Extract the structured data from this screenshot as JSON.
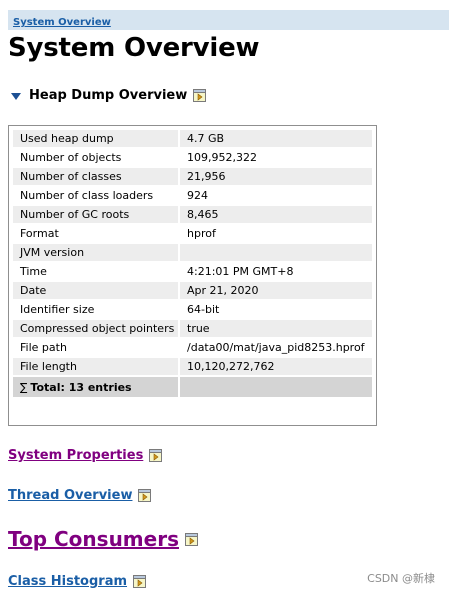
{
  "breadcrumb": {
    "label": "System Overview"
  },
  "page_title": "System Overview",
  "heap_section": {
    "title": "Heap Dump Overview"
  },
  "overview_table": {
    "rows": [
      {
        "key": "Used heap dump",
        "value": "4.7 GB"
      },
      {
        "key": "Number of objects",
        "value": "109,952,322"
      },
      {
        "key": "Number of classes",
        "value": "21,956"
      },
      {
        "key": "Number of class loaders",
        "value": "924"
      },
      {
        "key": "Number of GC roots",
        "value": "8,465"
      },
      {
        "key": "Format",
        "value": "hprof"
      },
      {
        "key": "JVM version",
        "value": ""
      },
      {
        "key": "Time",
        "value": "4:21:01 PM GMT+8"
      },
      {
        "key": "Date",
        "value": "Apr 21, 2020"
      },
      {
        "key": "Identifier size",
        "value": "64-bit"
      },
      {
        "key": "Compressed object pointers",
        "value": "true"
      },
      {
        "key": "File path",
        "value": "/data00/mat/java_pid8253.hprof"
      },
      {
        "key": "File length",
        "value": "10,120,272,762"
      }
    ],
    "total_sigma": "∑",
    "total_label": "Total: 13 entries"
  },
  "links": {
    "system_properties": "System Properties",
    "thread_overview": "Thread Overview",
    "top_consumers": "Top Consumers",
    "class_histogram": "Class Histogram"
  },
  "watermark": "CSDN @新棣",
  "icons": {
    "detach": "detach-icon",
    "expand": "triangle-down-icon"
  },
  "colors": {
    "breadcrumb_bg": "#d6e4f0",
    "link": "#1a5ea6",
    "visited_link": "#800080",
    "row_alt": "#ededed",
    "total_row": "#d4d4d4"
  }
}
